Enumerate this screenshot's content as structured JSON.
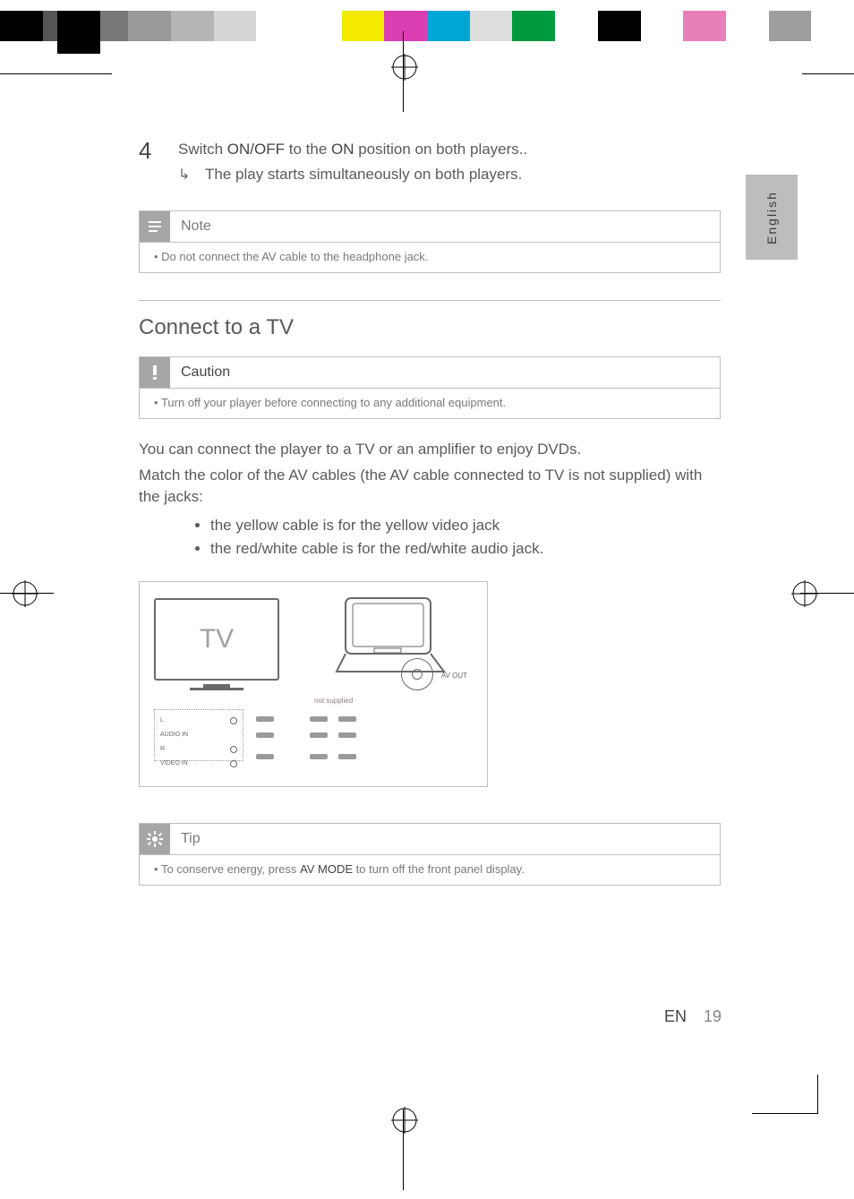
{
  "color_swatches": [
    "#000000",
    "#555555",
    "#777777",
    "#999999",
    "#b5b5b5",
    "#d5d5d5",
    "#ffffff",
    "#ffffff",
    "#f4ea00",
    "#d93fb0",
    "#00a6d6",
    "#dedede",
    "#009a3d",
    "#ffffff",
    "#000000",
    "#ffffff",
    "#e87fb8",
    "#ffffff",
    "#9e9e9e",
    "#ffffff"
  ],
  "side_tab": {
    "label": "English"
  },
  "step4": {
    "num": "4",
    "text_pre": "Switch ",
    "bold1": "ON/OFF",
    "text_mid": " to the ",
    "bold2": "ON",
    "text_post": " position on both players..",
    "sub_arrow": "↳",
    "sub_text": "The play starts simultaneously on both players."
  },
  "note_box": {
    "title": "Note",
    "body": "Do not connect the AV cable to the headphone jack."
  },
  "section_heading": "Connect to a TV",
  "caution_box": {
    "title": "Caution",
    "body": "Turn off your player before connecting to any additional equipment."
  },
  "para1": "You can connect the player to a TV or an amplifier to enjoy DVDs.",
  "para2": "Match the color of the AV cables (the AV cable connected to TV is not supplied) with the jacks:",
  "bullets": [
    "the yellow cable is for the yellow video jack",
    "the red/white cable is for the red/white audio jack."
  ],
  "wiring": {
    "tv_label": "TV",
    "not_supplied": "not supplied",
    "av_out": "AV OUT",
    "jacks": {
      "l": "L",
      "audio_in": "AUDIO IN",
      "r": "R",
      "video_in": "VIDEO IN"
    }
  },
  "tip_box": {
    "title": "Tip",
    "body_pre": "To conserve energy, press ",
    "bold": "AV MODE",
    "body_post": " to turn off the front panel display."
  },
  "footer": {
    "lang": "EN",
    "page": "19"
  }
}
